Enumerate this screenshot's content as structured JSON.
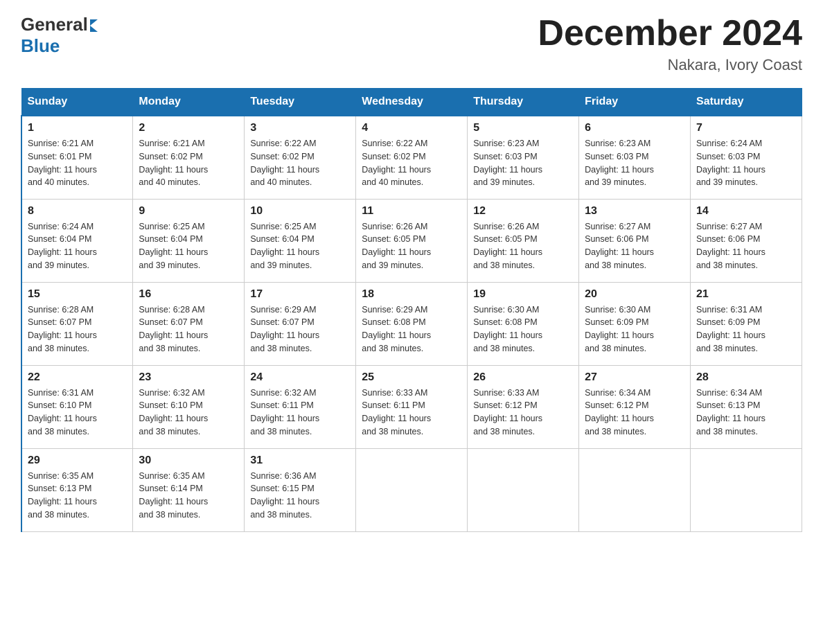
{
  "header": {
    "logo_general": "General",
    "logo_blue": "Blue",
    "month_title": "December 2024",
    "location": "Nakara, Ivory Coast"
  },
  "days_of_week": [
    "Sunday",
    "Monday",
    "Tuesday",
    "Wednesday",
    "Thursday",
    "Friday",
    "Saturday"
  ],
  "weeks": [
    [
      {
        "num": "1",
        "sunrise": "6:21 AM",
        "sunset": "6:01 PM",
        "daylight": "11 hours and 40 minutes."
      },
      {
        "num": "2",
        "sunrise": "6:21 AM",
        "sunset": "6:02 PM",
        "daylight": "11 hours and 40 minutes."
      },
      {
        "num": "3",
        "sunrise": "6:22 AM",
        "sunset": "6:02 PM",
        "daylight": "11 hours and 40 minutes."
      },
      {
        "num": "4",
        "sunrise": "6:22 AM",
        "sunset": "6:02 PM",
        "daylight": "11 hours and 40 minutes."
      },
      {
        "num": "5",
        "sunrise": "6:23 AM",
        "sunset": "6:03 PM",
        "daylight": "11 hours and 39 minutes."
      },
      {
        "num": "6",
        "sunrise": "6:23 AM",
        "sunset": "6:03 PM",
        "daylight": "11 hours and 39 minutes."
      },
      {
        "num": "7",
        "sunrise": "6:24 AM",
        "sunset": "6:03 PM",
        "daylight": "11 hours and 39 minutes."
      }
    ],
    [
      {
        "num": "8",
        "sunrise": "6:24 AM",
        "sunset": "6:04 PM",
        "daylight": "11 hours and 39 minutes."
      },
      {
        "num": "9",
        "sunrise": "6:25 AM",
        "sunset": "6:04 PM",
        "daylight": "11 hours and 39 minutes."
      },
      {
        "num": "10",
        "sunrise": "6:25 AM",
        "sunset": "6:04 PM",
        "daylight": "11 hours and 39 minutes."
      },
      {
        "num": "11",
        "sunrise": "6:26 AM",
        "sunset": "6:05 PM",
        "daylight": "11 hours and 39 minutes."
      },
      {
        "num": "12",
        "sunrise": "6:26 AM",
        "sunset": "6:05 PM",
        "daylight": "11 hours and 38 minutes."
      },
      {
        "num": "13",
        "sunrise": "6:27 AM",
        "sunset": "6:06 PM",
        "daylight": "11 hours and 38 minutes."
      },
      {
        "num": "14",
        "sunrise": "6:27 AM",
        "sunset": "6:06 PM",
        "daylight": "11 hours and 38 minutes."
      }
    ],
    [
      {
        "num": "15",
        "sunrise": "6:28 AM",
        "sunset": "6:07 PM",
        "daylight": "11 hours and 38 minutes."
      },
      {
        "num": "16",
        "sunrise": "6:28 AM",
        "sunset": "6:07 PM",
        "daylight": "11 hours and 38 minutes."
      },
      {
        "num": "17",
        "sunrise": "6:29 AM",
        "sunset": "6:07 PM",
        "daylight": "11 hours and 38 minutes."
      },
      {
        "num": "18",
        "sunrise": "6:29 AM",
        "sunset": "6:08 PM",
        "daylight": "11 hours and 38 minutes."
      },
      {
        "num": "19",
        "sunrise": "6:30 AM",
        "sunset": "6:08 PM",
        "daylight": "11 hours and 38 minutes."
      },
      {
        "num": "20",
        "sunrise": "6:30 AM",
        "sunset": "6:09 PM",
        "daylight": "11 hours and 38 minutes."
      },
      {
        "num": "21",
        "sunrise": "6:31 AM",
        "sunset": "6:09 PM",
        "daylight": "11 hours and 38 minutes."
      }
    ],
    [
      {
        "num": "22",
        "sunrise": "6:31 AM",
        "sunset": "6:10 PM",
        "daylight": "11 hours and 38 minutes."
      },
      {
        "num": "23",
        "sunrise": "6:32 AM",
        "sunset": "6:10 PM",
        "daylight": "11 hours and 38 minutes."
      },
      {
        "num": "24",
        "sunrise": "6:32 AM",
        "sunset": "6:11 PM",
        "daylight": "11 hours and 38 minutes."
      },
      {
        "num": "25",
        "sunrise": "6:33 AM",
        "sunset": "6:11 PM",
        "daylight": "11 hours and 38 minutes."
      },
      {
        "num": "26",
        "sunrise": "6:33 AM",
        "sunset": "6:12 PM",
        "daylight": "11 hours and 38 minutes."
      },
      {
        "num": "27",
        "sunrise": "6:34 AM",
        "sunset": "6:12 PM",
        "daylight": "11 hours and 38 minutes."
      },
      {
        "num": "28",
        "sunrise": "6:34 AM",
        "sunset": "6:13 PM",
        "daylight": "11 hours and 38 minutes."
      }
    ],
    [
      {
        "num": "29",
        "sunrise": "6:35 AM",
        "sunset": "6:13 PM",
        "daylight": "11 hours and 38 minutes."
      },
      {
        "num": "30",
        "sunrise": "6:35 AM",
        "sunset": "6:14 PM",
        "daylight": "11 hours and 38 minutes."
      },
      {
        "num": "31",
        "sunrise": "6:36 AM",
        "sunset": "6:15 PM",
        "daylight": "11 hours and 38 minutes."
      },
      null,
      null,
      null,
      null
    ]
  ],
  "labels": {
    "sunrise": "Sunrise:",
    "sunset": "Sunset:",
    "daylight": "Daylight:"
  }
}
